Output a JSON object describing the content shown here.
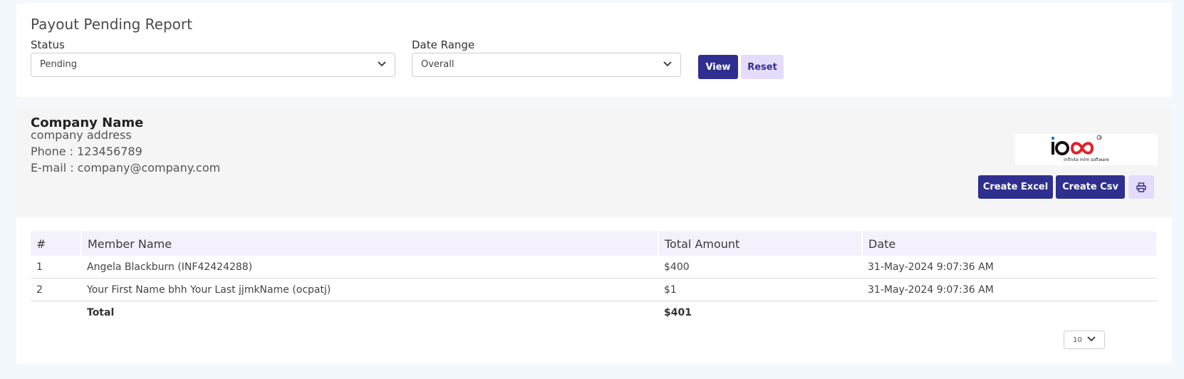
{
  "filter": {
    "title": "Payout Pending Report",
    "status_label": "Status",
    "status_value": "Pending",
    "date_range_label": "Date Range",
    "date_range_value": "Overall",
    "view_label": "View",
    "reset_label": "Reset"
  },
  "company": {
    "name": "Company Name",
    "address": "company address",
    "phone": "Phone : 123456789",
    "email": "E-mail : company@company.com",
    "logo_main": "io",
    "logo_tagline": "infinite mlm software",
    "logo_registered": "®"
  },
  "actions": {
    "create_excel": "Create Excel",
    "create_csv": "Create Csv",
    "print_icon": "printer-icon"
  },
  "table": {
    "headers": [
      "#",
      "Member Name",
      "Total Amount",
      "Date"
    ],
    "rows": [
      [
        "1",
        "Angela Blackburn (INF42424288)",
        "$400",
        "31-May-2024 9:07:36 AM"
      ],
      [
        "2",
        "Your First Name bhh Your Last jjmkName (ocpatj)",
        "$1",
        "31-May-2024 9:07:36 AM"
      ]
    ],
    "total_label": "Total",
    "total_value": "$401"
  },
  "pagination": {
    "per_page": "10"
  },
  "colors": {
    "primary": "#2f2f8f",
    "light_button": "#e5dcfb",
    "logo_red": "#e3202a"
  }
}
